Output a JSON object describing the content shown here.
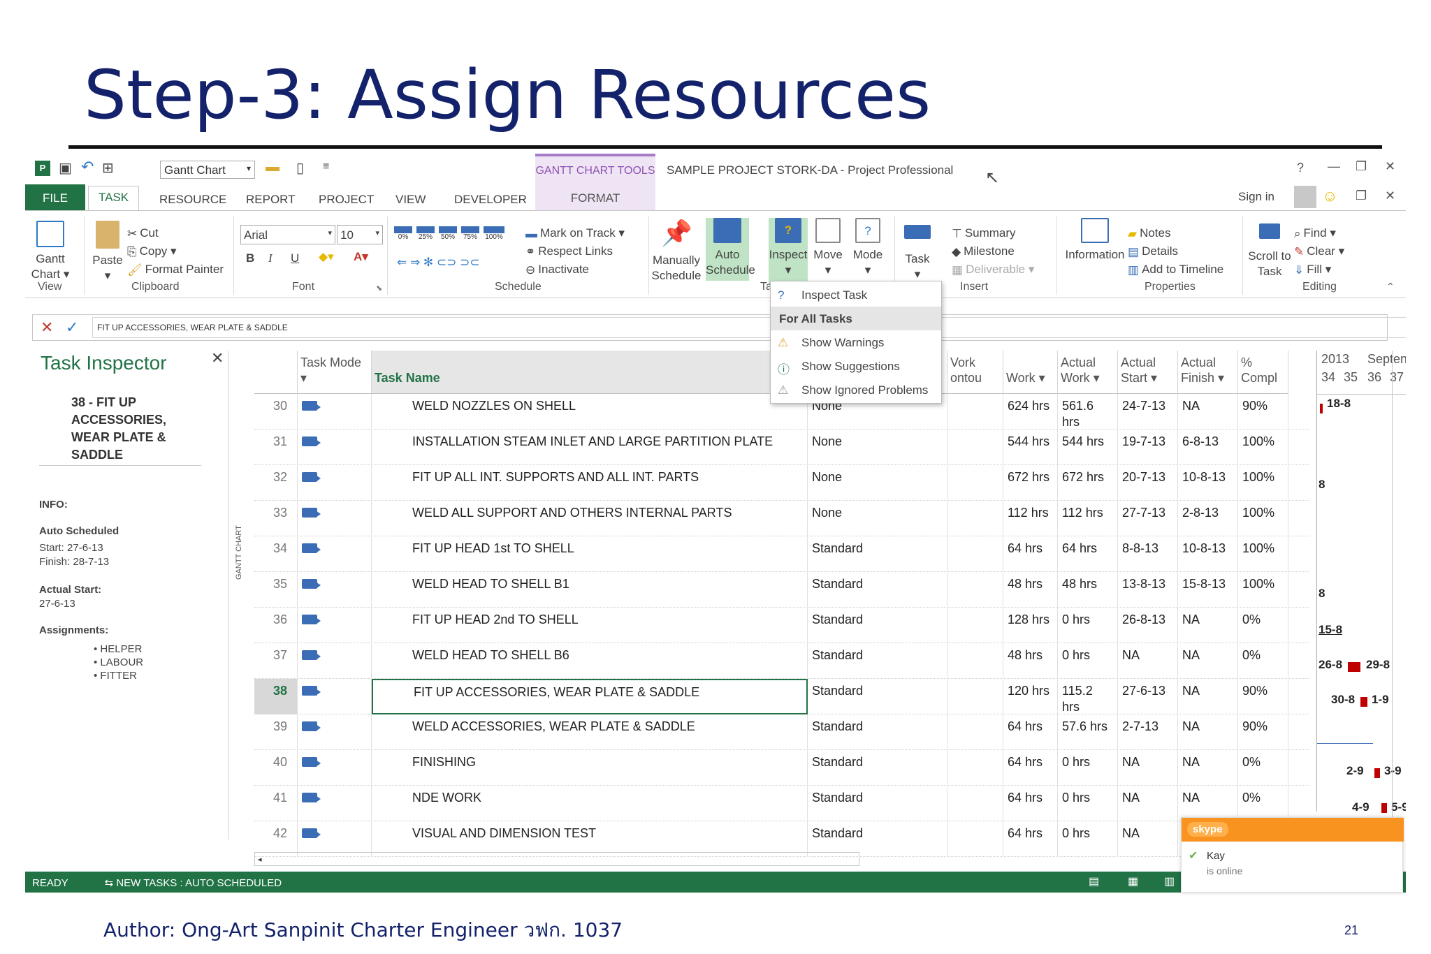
{
  "slide": {
    "title": "Step-3: Assign Resources",
    "footer": "Author: Ong-Art Sanpinit Charter Engineer วฟก. 1037",
    "page_number": "21"
  },
  "titlebar": {
    "view_combo": "Gantt Chart",
    "context_tools": "GANTT CHART TOOLS",
    "context_tab": "FORMAT",
    "window_title": "SAMPLE PROJECT STORK-DA - Project Professional",
    "help": "?",
    "sign_in": "Sign in"
  },
  "tabs": [
    "FILE",
    "TASK",
    "RESOURCE",
    "REPORT",
    "PROJECT",
    "VIEW",
    "DEVELOPER"
  ],
  "ribbon": {
    "view": {
      "button": "Gantt Chart",
      "label": "View"
    },
    "clipboard": {
      "paste": "Paste",
      "cut": "Cut",
      "copy": "Copy",
      "format_painter": "Format Painter",
      "label": "Clipboard"
    },
    "font": {
      "name": "Arial",
      "size": "10",
      "bold": "B",
      "italic": "I",
      "underline": "U",
      "label": "Font"
    },
    "schedule": {
      "pct": [
        "0%",
        "25%",
        "50%",
        "75%",
        "100%"
      ],
      "mark_on_track": "Mark on Track",
      "respect_links": "Respect Links",
      "inactivate": "Inactivate",
      "label": "Schedule"
    },
    "tasks": {
      "manually": "Manually Schedule",
      "auto": "Auto Schedule",
      "inspect": "Inspect",
      "move": "Move",
      "mode": "Mode",
      "label_fragment": "Ta"
    },
    "insert": {
      "task": "Task",
      "summary": "Summary",
      "milestone": "Milestone",
      "deliverable": "Deliverable",
      "label": "Insert"
    },
    "properties": {
      "information": "Information",
      "notes": "Notes",
      "details": "Details",
      "add_to_timeline": "Add to Timeline",
      "label": "Properties"
    },
    "editing": {
      "scroll_to_task": "Scroll to Task",
      "find": "Find",
      "clear": "Clear",
      "fill": "Fill",
      "label": "Editing"
    }
  },
  "entry_bar": {
    "value": "FIT UP ACCESSORIES, WEAR PLATE & SADDLE"
  },
  "inspector": {
    "title": "Task Inspector",
    "task": "38 - FIT UP ACCESSORIES, WEAR PLATE & SADDLE",
    "info_label": "INFO:",
    "auto_label": "Auto Scheduled",
    "start": "Start: 27-6-13",
    "finish": "Finish: 28-7-13",
    "actual_start_label": "Actual Start:",
    "actual_start": "27-6-13",
    "assignments_label": "Assignments:",
    "assignments": [
      "HELPER",
      "LABOUR",
      "FITTER"
    ],
    "side_label": "GANTT CHART"
  },
  "inspect_menu": {
    "inspect_task": "Inspect Task",
    "header": "For All Tasks",
    "items": [
      "Show Warnings",
      "Show Suggestions",
      "Show Ignored Problems"
    ]
  },
  "grid": {
    "columns": [
      "Task Mode",
      "Task Name",
      "Work Contour",
      "Work",
      "Actual Work",
      "Actual Start",
      "Actual Finish",
      "% Compl"
    ],
    "col_fragments": {
      "contour": "Vork ontou",
      "compl": "% Compl"
    },
    "rows": [
      {
        "id": "30",
        "name": "WELD NOZZLES ON SHELL",
        "contour": "None",
        "work": "624 hrs",
        "actual_work": "561.6 hrs",
        "actual_start": "24-7-13",
        "actual_finish": "NA",
        "pct": "90%"
      },
      {
        "id": "31",
        "name": "INSTALLATION STEAM INLET AND LARGE PARTITION PLATE",
        "contour": "None",
        "work": "544 hrs",
        "actual_work": "544 hrs",
        "actual_start": "19-7-13",
        "actual_finish": "6-8-13",
        "pct": "100%"
      },
      {
        "id": "32",
        "name": "FIT UP ALL INT. SUPPORTS AND ALL INT. PARTS",
        "contour": "None",
        "work": "672 hrs",
        "actual_work": "672 hrs",
        "actual_start": "20-7-13",
        "actual_finish": "10-8-13",
        "pct": "100%"
      },
      {
        "id": "33",
        "name": "WELD ALL SUPPORT AND OTHERS INTERNAL PARTS",
        "contour": "None",
        "work": "112 hrs",
        "actual_work": "112 hrs",
        "actual_start": "27-7-13",
        "actual_finish": "2-8-13",
        "pct": "100%"
      },
      {
        "id": "34",
        "name": "FIT UP HEAD 1st TO SHELL",
        "contour": "Standard",
        "work": "64 hrs",
        "actual_work": "64 hrs",
        "actual_start": "8-8-13",
        "actual_finish": "10-8-13",
        "pct": "100%"
      },
      {
        "id": "35",
        "name": "WELD HEAD TO SHELL B1",
        "contour": "Standard",
        "work": "48 hrs",
        "actual_work": "48 hrs",
        "actual_start": "13-8-13",
        "actual_finish": "15-8-13",
        "pct": "100%"
      },
      {
        "id": "36",
        "name": "FIT UP HEAD 2nd TO SHELL",
        "contour": "Standard",
        "work": "128 hrs",
        "actual_work": "0 hrs",
        "actual_start": "26-8-13",
        "actual_finish": "NA",
        "pct": "0%"
      },
      {
        "id": "37",
        "name": "WELD HEAD TO SHELL B6",
        "contour": "Standard",
        "work": "48 hrs",
        "actual_work": "0 hrs",
        "actual_start": "NA",
        "actual_finish": "NA",
        "pct": "0%"
      },
      {
        "id": "38",
        "name": "FIT UP ACCESSORIES, WEAR PLATE & SADDLE",
        "contour": "Standard",
        "work": "120 hrs",
        "actual_work": "115.2 hrs",
        "actual_start": "27-6-13",
        "actual_finish": "NA",
        "pct": "90%"
      },
      {
        "id": "39",
        "name": "WELD ACCESSORIES, WEAR PLATE & SADDLE",
        "contour": "Standard",
        "work": "64 hrs",
        "actual_work": "57.6 hrs",
        "actual_start": "2-7-13",
        "actual_finish": "NA",
        "pct": "90%"
      },
      {
        "id": "40",
        "name": "FINISHING",
        "contour": "Standard",
        "work": "64 hrs",
        "actual_work": "0 hrs",
        "actual_start": "NA",
        "actual_finish": "NA",
        "pct": "0%"
      },
      {
        "id": "41",
        "name": "NDE WORK",
        "contour": "Standard",
        "work": "64 hrs",
        "actual_work": "0 hrs",
        "actual_start": "NA",
        "actual_finish": "NA",
        "pct": "0%"
      },
      {
        "id": "42",
        "name": "VISUAL AND DIMENSION TEST",
        "contour": "Standard",
        "work": "64 hrs",
        "actual_work": "0 hrs",
        "actual_start": "NA",
        "actual_finish": "",
        "pct": ""
      }
    ]
  },
  "gantt": {
    "year": "2013",
    "month": "Septen",
    "weeks": [
      "34",
      "35",
      "36",
      "37"
    ],
    "labels": {
      "r30": "18-8",
      "r32": "8",
      "r34": "8",
      "r35": "15-8",
      "r36a": "26-8",
      "r36b": "29-8",
      "r37a": "30-8",
      "r37b": "1-9",
      "r40a": "2-9",
      "r40b": "3-9",
      "r41a": "4-9",
      "r41b": "5-9"
    }
  },
  "status": {
    "ready": "READY",
    "new_tasks": "NEW TASKS : AUTO SCHEDULED"
  },
  "skype": {
    "brand": "skype",
    "user": "Kay",
    "presence": "is online"
  },
  "colors": {
    "title": "#13226b",
    "accent": "#217346",
    "context": "#8e52b3",
    "bar": "#c00000"
  }
}
